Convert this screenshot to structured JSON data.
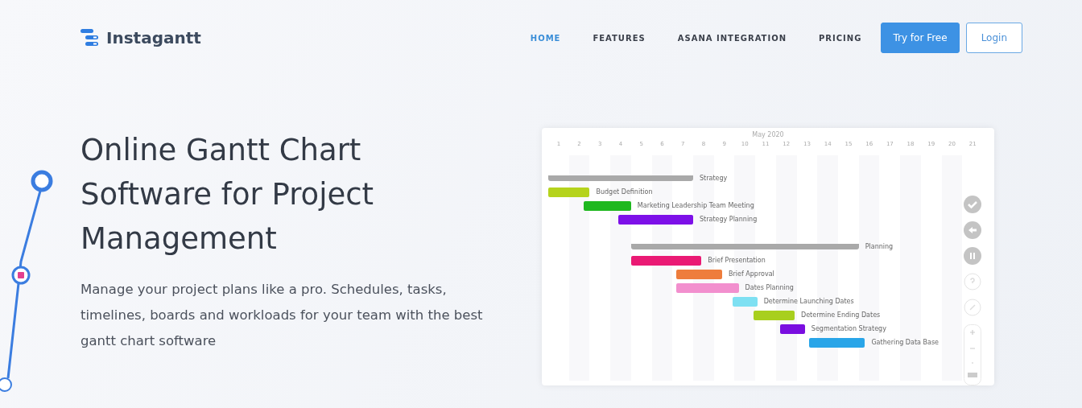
{
  "brand": {
    "name": "Instagantt"
  },
  "nav": [
    {
      "label": "HOME",
      "selected": true
    },
    {
      "label": "FEATURES",
      "selected": false
    },
    {
      "label": "ASANA INTEGRATION",
      "selected": false
    },
    {
      "label": "PRICING",
      "selected": false
    }
  ],
  "actions": [
    {
      "label": "Try for Free",
      "kind": "primary"
    },
    {
      "label": "Login",
      "kind": "outline"
    }
  ],
  "hero": {
    "title": "Online Gantt Chart Software for Project Management",
    "text": "Manage your project plans like a pro. Schedules, tasks, timelines, boards and workloads for your team with the best gantt chart software"
  },
  "gantt": {
    "month": "May 2020",
    "days": [
      "1",
      "2",
      "3",
      "4",
      "5",
      "6",
      "7",
      "8",
      "9",
      "10",
      "11",
      "12",
      "13",
      "14",
      "15",
      "16",
      "17",
      "18",
      "19",
      "20",
      "21"
    ],
    "tasks": [
      {
        "name": "Strategy",
        "kind": "group",
        "color": "#a9a9a9"
      },
      {
        "name": "Budget Definition",
        "kind": "task",
        "color": "#b5d31c"
      },
      {
        "name": "Marketing Leadership Team Meeting",
        "kind": "task",
        "color": "#1fb81f"
      },
      {
        "name": "Strategy Planning",
        "kind": "task",
        "color": "#7d10e8"
      },
      {
        "name": "Planning",
        "kind": "group",
        "color": "#a9a9a9"
      },
      {
        "name": "Brief Presentation",
        "kind": "task",
        "color": "#ea1a74"
      },
      {
        "name": "Brief Approval",
        "kind": "task",
        "color": "#ee7d3c"
      },
      {
        "name": "Dates Planning",
        "kind": "task",
        "color": "#f28fce"
      },
      {
        "name": "Determine Launching Dates",
        "kind": "task",
        "color": "#7ee0f2"
      },
      {
        "name": "Determine Ending Dates",
        "kind": "task",
        "color": "#a8cf1e"
      },
      {
        "name": "Segmentation Strategy",
        "kind": "task",
        "color": "#7a0ee0"
      },
      {
        "name": "Gathering Data Base",
        "kind": "task",
        "color": "#29a5e8"
      }
    ]
  }
}
